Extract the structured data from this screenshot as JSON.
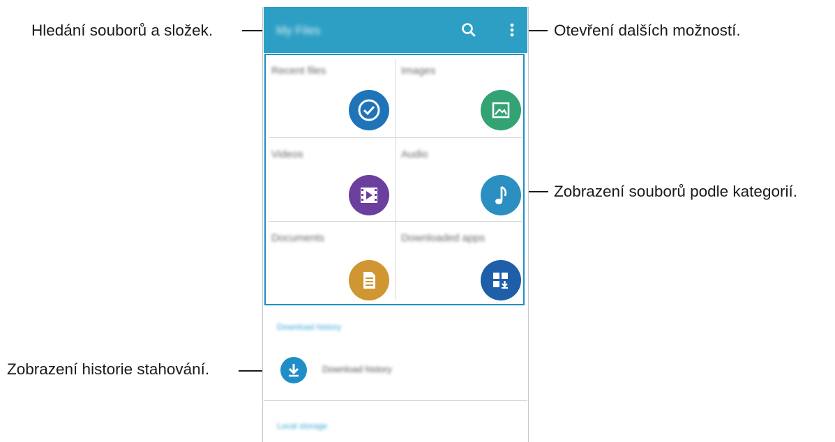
{
  "callouts": {
    "search": "Hledání souborů a složek.",
    "more": "Otevření dalších možností.",
    "categories": "Zobrazení souborů podle kategorií.",
    "download_history": "Zobrazení historie stahování."
  },
  "app": {
    "title": "My Files",
    "accent": "#2e9fc4",
    "categories": [
      {
        "label": "Recent files",
        "icon": "clock-icon",
        "color": "#1f73b7"
      },
      {
        "label": "Images",
        "icon": "image-icon",
        "color": "#33a374"
      },
      {
        "label": "Videos",
        "icon": "video-icon",
        "color": "#6a3f9e"
      },
      {
        "label": "Audio",
        "icon": "music-note-icon",
        "color": "#2b8fc2"
      },
      {
        "label": "Documents",
        "icon": "document-icon",
        "color": "#cf9631"
      },
      {
        "label": "Downloaded apps",
        "icon": "download-apps-icon",
        "color": "#1f5fa9"
      }
    ],
    "download_section_header": "Download history",
    "download_history_label": "Download history",
    "storage_section_header": "Local storage"
  }
}
